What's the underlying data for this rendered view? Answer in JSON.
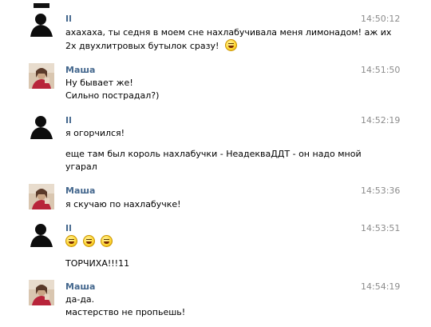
{
  "messages": [
    {
      "sender": "Il",
      "time": "14:50:12",
      "avatar": "silhouette-avatar",
      "lines": [
        "ахахаха, ты седня в моем сне нахлабучивала меня лимонадом! аж их",
        "2х двухлитровых бутылок сразу!"
      ],
      "emoji_after_last_line": 1
    },
    {
      "sender": "Маша",
      "time": "14:51:50",
      "avatar": "photo-avatar",
      "lines": [
        "Ну бывает же!",
        "Сильно пострадал?)"
      ]
    },
    {
      "sender": "Il",
      "time": "14:52:19",
      "avatar": "silhouette-avatar",
      "lines": [
        "я огорчился!",
        "еще там был король нахлабучки - НеадекваДДТ - он надо мной",
        "угарал"
      ]
    },
    {
      "sender": "Маша",
      "time": "14:53:36",
      "avatar": "photo-avatar",
      "lines": [
        "я скучаю по нахлабучке!"
      ]
    },
    {
      "sender": "Il",
      "time": "14:53:51",
      "avatar": "silhouette-avatar",
      "emoji_count": 3,
      "lines": [
        "ТОРЧИХА!!!11"
      ]
    },
    {
      "sender": "Маша",
      "time": "14:54:19",
      "avatar": "photo-avatar",
      "lines": [
        "да-да.",
        "мастерство не пропьешь!"
      ]
    }
  ]
}
